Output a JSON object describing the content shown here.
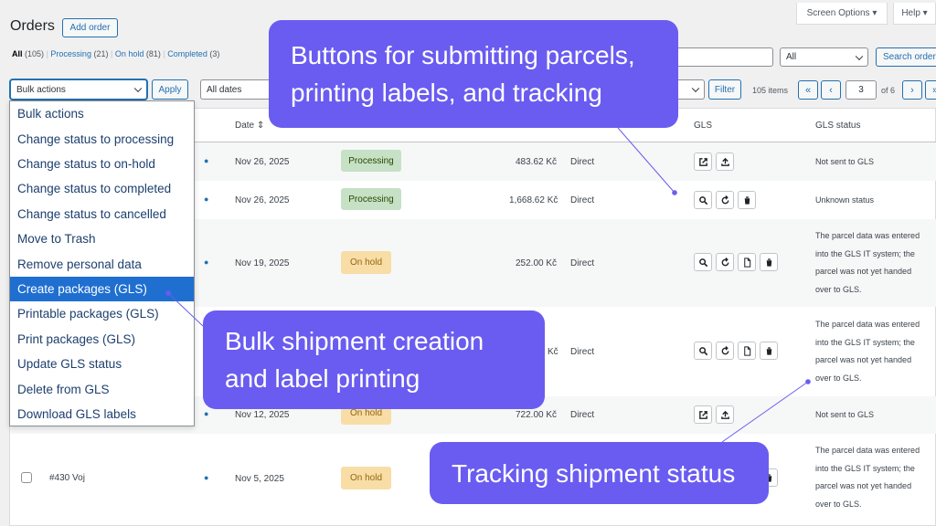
{
  "top": {
    "title": "Orders",
    "add_order": "Add order",
    "screen_options": "Screen Options ▾",
    "help": "Help ▾",
    "filters": {
      "all": "All",
      "all_count": "(105)",
      "processing": "Processing",
      "processing_count": "(21)",
      "on_hold": "On hold",
      "on_hold_count": "(81)",
      "completed": "Completed",
      "completed_count": "(3)"
    },
    "search_select": "All",
    "search_button": "Search orders",
    "bulk_select": "Bulk actions",
    "apply": "Apply",
    "dates": "All dates",
    "filter": "Filter",
    "items": "105 items",
    "first": "«",
    "prev": "‹",
    "page": "3",
    "of_pages": "of 6",
    "next": "›",
    "last": "»"
  },
  "columns": {
    "date": "Date ⇕",
    "gls": "GLS",
    "gls_status": "GLS status"
  },
  "rows": [
    {
      "date": "Nov 26, 2025",
      "status": "Processing",
      "total": "483.62 Kč",
      "origin": "Direct",
      "gls_status": "Not sent to GLS"
    },
    {
      "date": "Nov 26, 2025",
      "status": "Processing",
      "total": "1,668.62 Kč",
      "origin": "Direct",
      "gls_status": "Unknown status"
    },
    {
      "date": "Nov 19, 2025",
      "status": "On hold",
      "total": "252.00 Kč",
      "origin": "Direct",
      "gls_status": [
        "The parcel data was entered",
        "into the GLS IT system; the",
        "parcel was not yet handed",
        "over to GLS."
      ]
    },
    {
      "total_partial": "Kč",
      "origin": "Direct",
      "gls_status": [
        "The parcel data was entered",
        "into the GLS IT system; the",
        "parcel was not yet handed",
        "over to GLS."
      ]
    },
    {
      "date": "Nov 12, 2025",
      "status": "On hold",
      "total": "722.00 Kč",
      "origin": "Direct",
      "gls_status": "Not sent to GLS"
    },
    {
      "order": "#430 Voj",
      "date": "Nov 5, 2025",
      "status": "On hold",
      "gls_status": [
        "The parcel data was entered",
        "into the GLS IT system; the",
        "parcel was not yet handed",
        "over to GLS."
      ]
    }
  ],
  "bulk_menu": [
    "Bulk actions",
    "Change status to processing",
    "Change status to on-hold",
    "Change status to completed",
    "Change status to cancelled",
    "Move to Trash",
    "Remove personal data",
    "Create packages (GLS)",
    "Printable packages (GLS)",
    "Print packages (GLS)",
    "Update GLS status",
    "Delete from GLS",
    "Download GLS labels"
  ],
  "bulk_menu_selected": "Create packages (GLS)",
  "callouts": {
    "buttons_line1": "Buttons for submitting parcels,",
    "buttons_line2": "printing labels, and tracking",
    "bulk_line1": "Bulk shipment creation",
    "bulk_line2": "and label printing",
    "tracking": "Tracking shipment status"
  },
  "colors": {
    "callout": "#6a5cf0",
    "selected": "#1f6fd1",
    "processing_bg": "#c6e1c6",
    "on_hold_bg": "#f8dda7",
    "link": "#2271b1"
  },
  "icons": [
    "external-link-icon",
    "upload-icon",
    "search-icon",
    "refresh-icon",
    "document-icon",
    "trash-icon",
    "eye-icon"
  ]
}
